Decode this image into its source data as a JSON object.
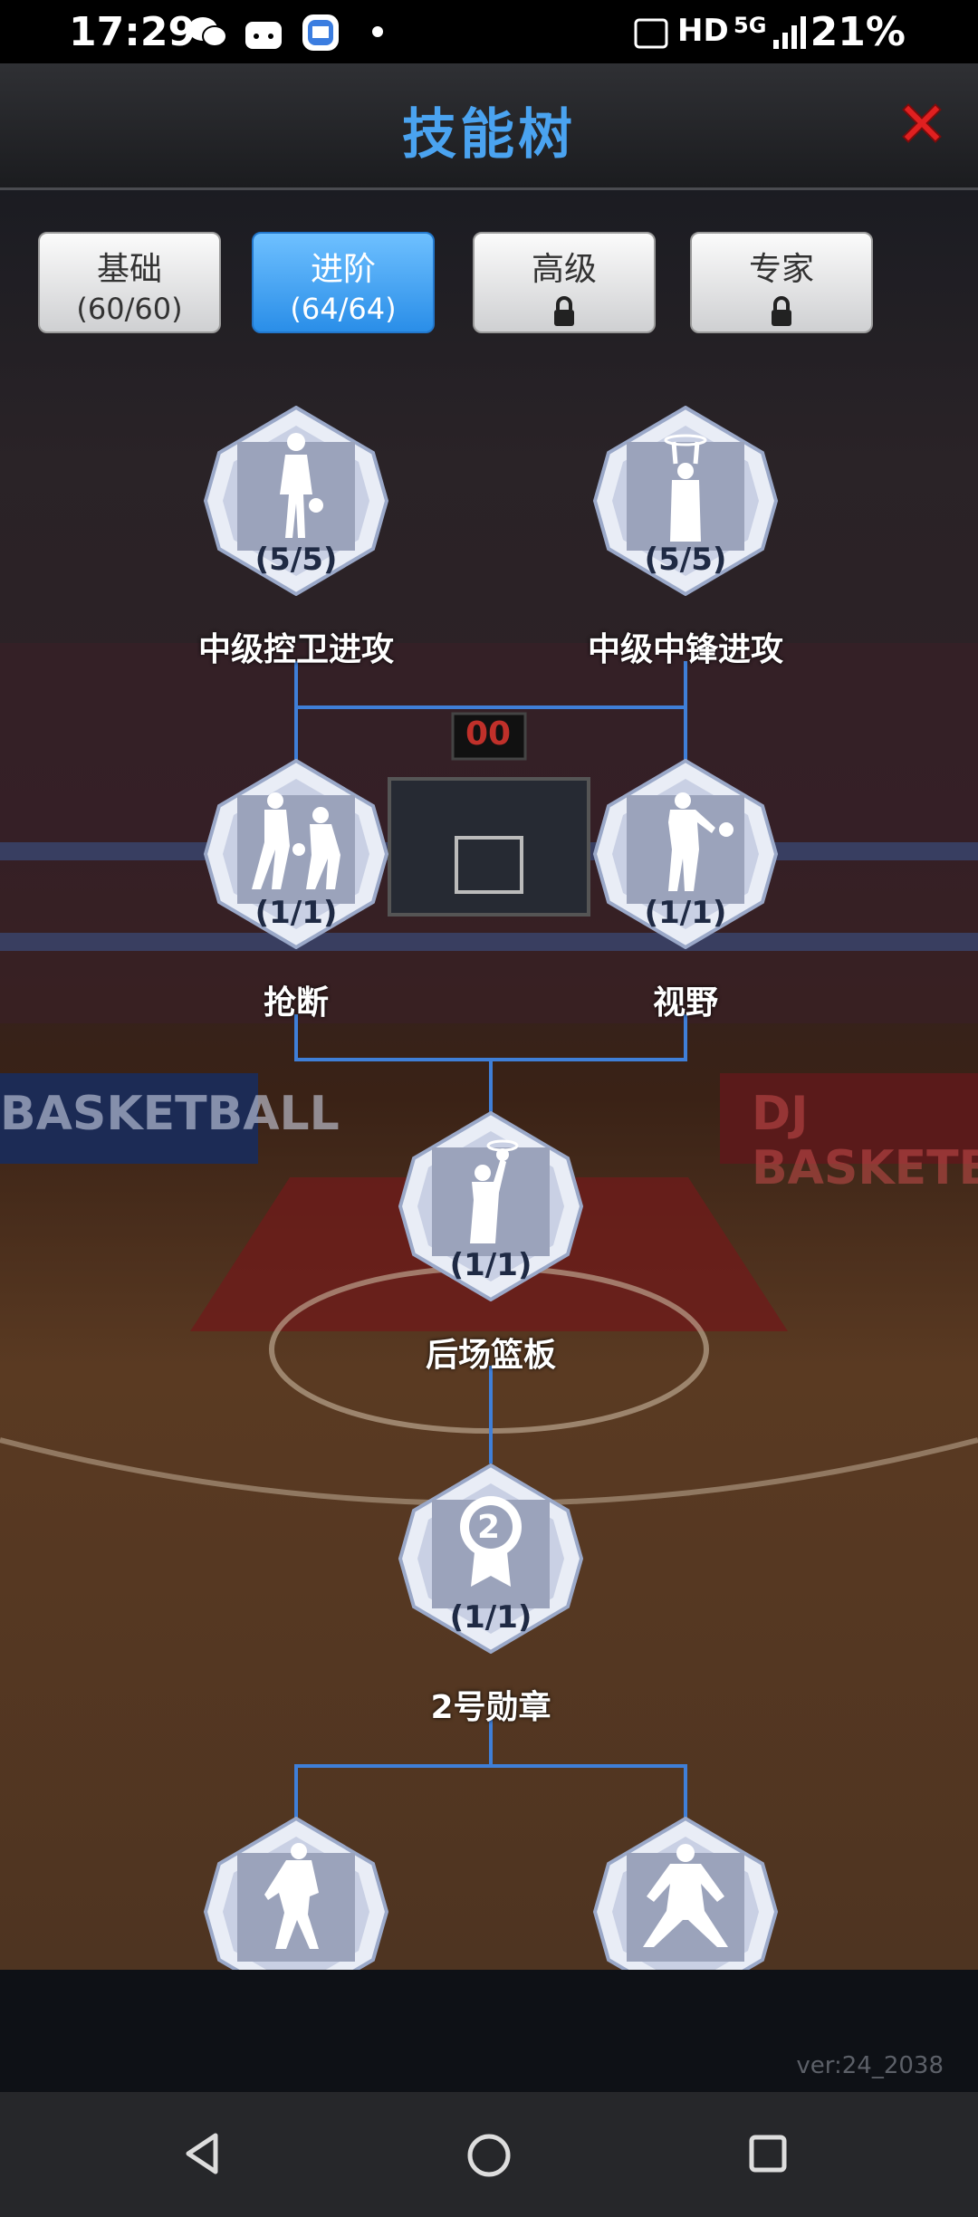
{
  "status": {
    "time": "17:29",
    "network": "HD",
    "signal": "5G",
    "battery": "21%"
  },
  "header": {
    "title": "技能树"
  },
  "tabs": [
    {
      "label": "基础",
      "progress": "(60/60)",
      "locked": false,
      "active": false
    },
    {
      "label": "进阶",
      "progress": "(64/64)",
      "locked": false,
      "active": true
    },
    {
      "label": "高级",
      "progress": "",
      "locked": true,
      "active": false
    },
    {
      "label": "专家",
      "progress": "",
      "locked": true,
      "active": false
    }
  ],
  "nodes": [
    {
      "label": "中级控卫进攻",
      "count": "(5/5)",
      "icon": "dribbler-icon"
    },
    {
      "label": "中级中锋进攻",
      "count": "(5/5)",
      "icon": "dunk-icon"
    },
    {
      "label": "抢断",
      "count": "(1/1)",
      "icon": "steal-icon"
    },
    {
      "label": "视野",
      "count": "(1/1)",
      "icon": "pass-icon"
    },
    {
      "label": "后场篮板",
      "count": "(1/1)",
      "icon": "rebound-icon"
    },
    {
      "label": "2号勋章",
      "count": "(1/1)",
      "icon": "medal-icon",
      "medal_number": "2"
    },
    {
      "label": "",
      "count": "",
      "icon": "defender-icon"
    },
    {
      "label": "",
      "count": "",
      "icon": "defense-stance-icon"
    }
  ],
  "background": {
    "banner_left": "BASKETBALL",
    "banner_right": "DJ BASKETB",
    "scoreboard": "00"
  },
  "footer": {
    "version": "ver:24_2038"
  },
  "colors": {
    "title_blue": "#4aa3f0",
    "connector_blue": "#3f7fd8",
    "active_tab": "#2a8ee8",
    "close_red": "#e02020"
  }
}
